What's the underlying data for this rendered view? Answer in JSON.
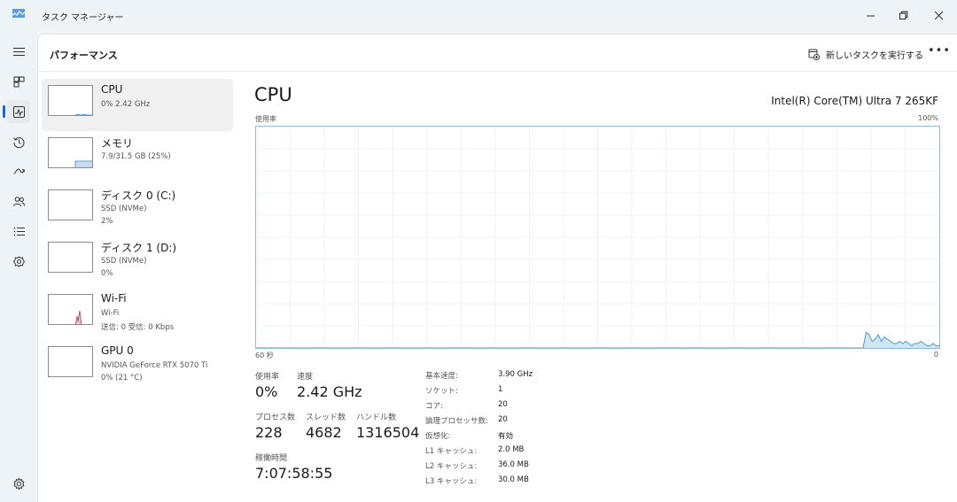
{
  "window": {
    "title": "タスク マネージャー",
    "minimize_icon": "minimize-icon",
    "restore_icon": "restore-icon",
    "close_icon": "close-icon"
  },
  "rail": {
    "items": [
      {
        "name": "hamburger-menu-icon"
      },
      {
        "name": "processes-icon"
      },
      {
        "name": "performance-icon",
        "active": true
      },
      {
        "name": "app-history-icon"
      },
      {
        "name": "startup-apps-icon"
      },
      {
        "name": "users-icon"
      },
      {
        "name": "details-icon"
      },
      {
        "name": "services-icon"
      },
      {
        "name": "settings-icon"
      }
    ]
  },
  "header": {
    "title": "パフォーマンス",
    "run_task": "新しいタスクを実行する",
    "more": "•••"
  },
  "devices": [
    {
      "name": "CPU",
      "sub1": "0% 2.42 GHz",
      "sub2": "",
      "sub3": "",
      "color": "#1a7fc4"
    },
    {
      "name": "メモリ",
      "sub1": "7.9/31.5 GB (25%)",
      "sub2": "",
      "sub3": "",
      "color": "#4a8ac9"
    },
    {
      "name": "ディスク 0 (C:)",
      "sub1": "SSD (NVMe)",
      "sub2": "2%",
      "sub3": "",
      "color": "#4c9a2a"
    },
    {
      "name": "ディスク 1 (D:)",
      "sub1": "SSD (NVMe)",
      "sub2": "0%",
      "sub3": "",
      "color": "#4c9a2a"
    },
    {
      "name": "Wi-Fi",
      "sub1": "Wi-Fi",
      "sub2": "送信: 0 受信: 0 Kbps",
      "sub3": "",
      "color": "#a7396b"
    },
    {
      "name": "GPU 0",
      "sub1": "NVIDIA GeForce RTX 5070 Ti",
      "sub2": "0% (21 °C)",
      "sub3": "",
      "color": "#2e7d9c"
    }
  ],
  "detail": {
    "title": "CPU",
    "model": "Intel(R) Core(TM) Ultra 7 265KF",
    "graph_label_left": "使用率",
    "graph_label_right": "100%",
    "axis_left": "60 秒",
    "axis_right": "0",
    "graph_line_color": "#4b9bd1",
    "graph_fill_color": "#cfe6f5",
    "usage_history_percent": [
      0,
      0,
      0,
      0,
      0,
      0,
      0,
      0,
      0,
      0,
      0,
      0,
      0,
      0,
      0,
      0,
      0,
      0,
      0,
      0,
      0,
      0,
      0,
      0,
      0,
      0,
      0,
      0,
      0,
      0,
      0,
      0,
      0,
      0,
      0,
      0,
      0,
      0,
      0,
      0,
      0,
      0,
      0,
      0,
      0,
      0,
      0,
      0,
      0,
      0,
      0,
      0,
      0,
      0,
      0,
      0,
      0,
      0,
      0,
      0,
      0,
      0,
      0,
      0,
      0,
      0,
      0,
      0,
      0,
      0,
      0,
      0,
      0,
      0,
      0,
      0,
      0,
      0,
      0,
      0,
      0,
      0,
      0,
      0,
      0,
      0,
      0,
      0,
      0,
      0,
      0,
      0,
      0,
      0,
      0,
      0,
      0,
      0,
      0,
      0,
      0,
      0,
      0,
      0,
      0,
      0,
      0,
      0,
      0,
      0,
      0,
      0,
      0,
      0,
      0,
      0,
      0,
      0,
      0,
      0,
      0,
      0,
      0,
      0,
      0,
      0,
      0,
      0,
      0,
      0,
      0,
      0,
      0,
      0,
      0,
      0,
      0,
      0,
      0,
      0,
      0,
      0,
      0,
      0,
      0,
      0,
      0,
      0,
      0,
      0,
      0,
      0,
      0,
      0,
      0,
      0,
      0,
      0,
      0,
      0,
      0,
      0,
      0,
      0,
      0,
      0,
      0,
      0,
      0,
      0,
      0,
      0,
      0,
      0,
      0,
      0,
      0,
      0,
      0,
      0,
      0,
      0,
      0,
      0,
      0,
      0,
      0,
      0,
      0,
      0,
      0,
      0,
      0,
      0,
      0,
      0,
      0,
      0,
      0,
      0,
      7,
      6,
      3,
      4,
      6,
      3,
      5,
      4,
      3,
      2,
      2,
      3,
      2,
      3,
      2,
      1,
      2,
      2,
      3,
      2,
      1,
      1,
      2,
      1,
      1
    ],
    "stats": {
      "usage_label": "使用率",
      "usage_value": "0%",
      "speed_label": "速度",
      "speed_value": "2.42 GHz",
      "processes_label": "プロセス数",
      "processes_value": "228",
      "threads_label": "スレッド数",
      "threads_value": "4682",
      "handles_label": "ハンドル数",
      "handles_value": "1316504",
      "uptime_label": "稼働時間",
      "uptime_value": "7:07:58:55"
    },
    "specs": [
      {
        "key": "基本速度:",
        "value": "3.90 GHz"
      },
      {
        "key": "ソケット:",
        "value": "1"
      },
      {
        "key": "コア:",
        "value": "20"
      },
      {
        "key": "論理プロセッサ数:",
        "value": "20"
      },
      {
        "key": "仮想化:",
        "value": "有効"
      },
      {
        "key": "L1 キャッシュ:",
        "value": "2.0 MB"
      },
      {
        "key": "L2 キャッシュ:",
        "value": "36.0 MB"
      },
      {
        "key": "L3 キャッシュ:",
        "value": "30.0 MB"
      }
    ]
  }
}
